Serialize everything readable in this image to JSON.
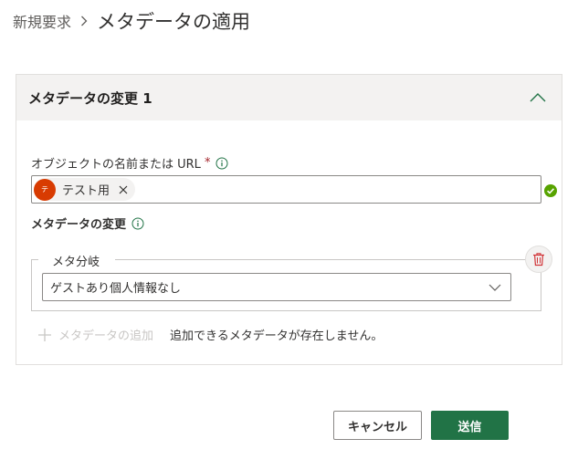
{
  "breadcrumb": {
    "parent": "新規要求",
    "current": "メタデータの適用"
  },
  "panel": {
    "title": "メタデータの変更 1"
  },
  "object_field": {
    "label": "オブジェクトの名前または URL",
    "required_mark": "*",
    "selected": {
      "avatar_initial": "テ",
      "name": "テスト用"
    }
  },
  "metadata_change": {
    "label": "メタデータの変更",
    "group_legend": "メタ分岐",
    "selected_value": "ゲストあり個人情報なし"
  },
  "add_metadata": {
    "button_label": "メタデータの追加",
    "note": "追加できるメタデータが存在しません。"
  },
  "footer": {
    "cancel_label": "キャンセル",
    "submit_label": "送信"
  },
  "colors": {
    "accent_green": "#217346",
    "avatar": "#d83b01",
    "valid": "#57a300",
    "delete": "#d13438"
  }
}
